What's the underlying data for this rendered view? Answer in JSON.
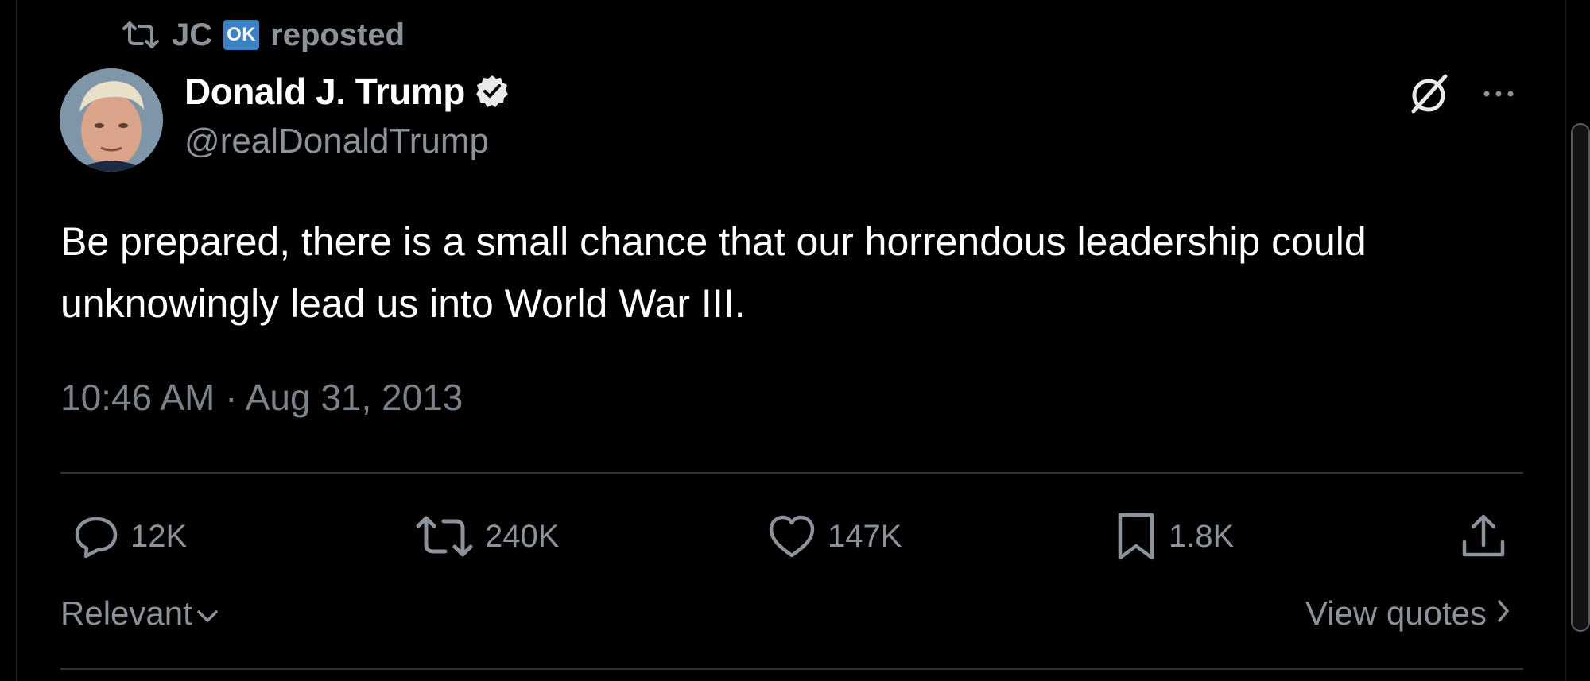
{
  "repost": {
    "user": "JC",
    "badge": "OK",
    "label": "reposted"
  },
  "author": {
    "display_name": "Donald J. Trump",
    "handle": "@realDonaldTrump",
    "verified": true,
    "avatar_icon": "avatar-photo"
  },
  "post": {
    "text": "Be prepared, there is a small chance that our horrendous leadership could unknowingly lead us into World War III.",
    "timestamp": "10:46 AM · Aug 31, 2013"
  },
  "stats": {
    "replies": "12K",
    "reposts": "240K",
    "likes": "147K",
    "bookmarks": "1.8K"
  },
  "footer": {
    "sort_label": "Relevant",
    "view_quotes_label": "View quotes"
  },
  "icons": {
    "grok": "grok-icon",
    "more": "more-icon",
    "reply": "reply-icon",
    "repost": "repost-icon",
    "like": "heart-icon",
    "bookmark": "bookmark-icon",
    "share": "share-icon"
  },
  "colors": {
    "background": "#000000",
    "text_primary": "#ffffff",
    "text_secondary": "#8b9299",
    "divider": "#2f3336",
    "ok_badge": "#3b82c4"
  }
}
